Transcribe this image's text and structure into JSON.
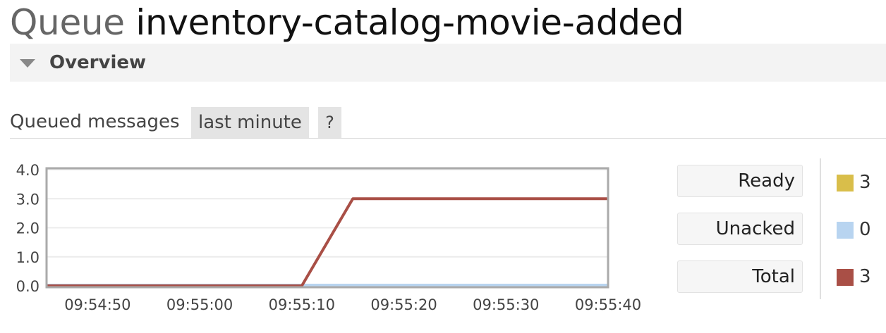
{
  "page": {
    "title_prefix": "Queue",
    "queue_name": "inventory-catalog-movie-added"
  },
  "overview": {
    "section_label": "Overview",
    "queued_messages_label": "Queued messages",
    "range_label": "last minute",
    "help_label": "?"
  },
  "colors": {
    "ready": "#d9be4a",
    "unacked": "#b8d4f0",
    "total": "#a94f46"
  },
  "legend": [
    {
      "label": "Ready",
      "count": "3"
    },
    {
      "label": "Unacked",
      "count": "0"
    },
    {
      "label": "Total",
      "count": "3"
    }
  ],
  "chart_data": {
    "type": "line",
    "x_ticks": [
      "09:54:50",
      "09:55:00",
      "09:55:10",
      "09:55:20",
      "09:55:30",
      "09:55:40"
    ],
    "y_ticks": [
      "0.0",
      "1.0",
      "2.0",
      "3.0",
      "4.0"
    ],
    "ylim": [
      0,
      4
    ],
    "xlim": [
      "09:54:45",
      "09:55:40"
    ],
    "grid": true,
    "series": [
      {
        "name": "Total",
        "x": [
          "09:54:45",
          "09:55:10",
          "09:55:15",
          "09:55:40"
        ],
        "y": [
          0,
          0,
          3,
          3
        ]
      },
      {
        "name": "Unacked",
        "x": [
          "09:54:45",
          "09:55:40"
        ],
        "y": [
          0,
          0
        ]
      }
    ]
  }
}
